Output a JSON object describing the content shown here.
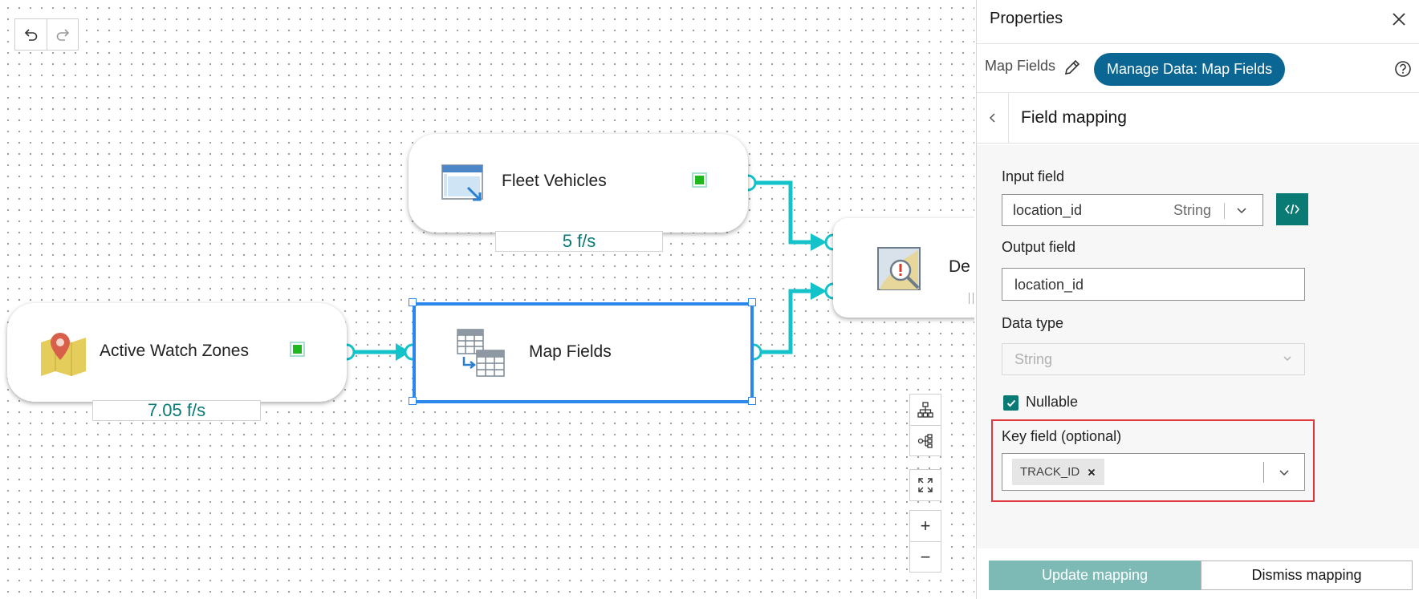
{
  "canvas": {
    "toolbar": {
      "undo_icon": "undo-icon",
      "redo_icon": "redo-icon"
    },
    "nodes": {
      "fleet": {
        "label": "Fleet Vehicles",
        "rate": "5 f/s"
      },
      "zones": {
        "label": "Active Watch Zones",
        "rate": "7.05 f/s"
      },
      "map_fields": {
        "label": "Map Fields"
      },
      "partial": {
        "label": "De"
      }
    },
    "controls": [
      "layout-icon",
      "tree-layout-icon",
      "fit-to-screen-icon"
    ],
    "zoom_in": "+",
    "zoom_out": "−"
  },
  "panel": {
    "title": "Properties",
    "tool_name": "Map Fields",
    "tool_chip": "Manage Data: Map Fields",
    "section_title": "Field mapping",
    "input_field": {
      "label": "Input field",
      "value": "location_id",
      "type": "String"
    },
    "output_field": {
      "label": "Output field",
      "value": "location_id"
    },
    "data_type": {
      "label": "Data type",
      "value": "String"
    },
    "nullable": {
      "label": "Nullable",
      "checked": true
    },
    "key_field": {
      "label": "Key field (optional)",
      "chip": "TRACK_ID"
    },
    "buttons": {
      "update": "Update mapping",
      "dismiss": "Dismiss mapping"
    }
  },
  "colors": {
    "accent_blue": "#0b6693",
    "teal": "#0a7a74",
    "connector": "#14c2c9",
    "selection": "#2b87ec",
    "highlight": "#e0393d"
  }
}
